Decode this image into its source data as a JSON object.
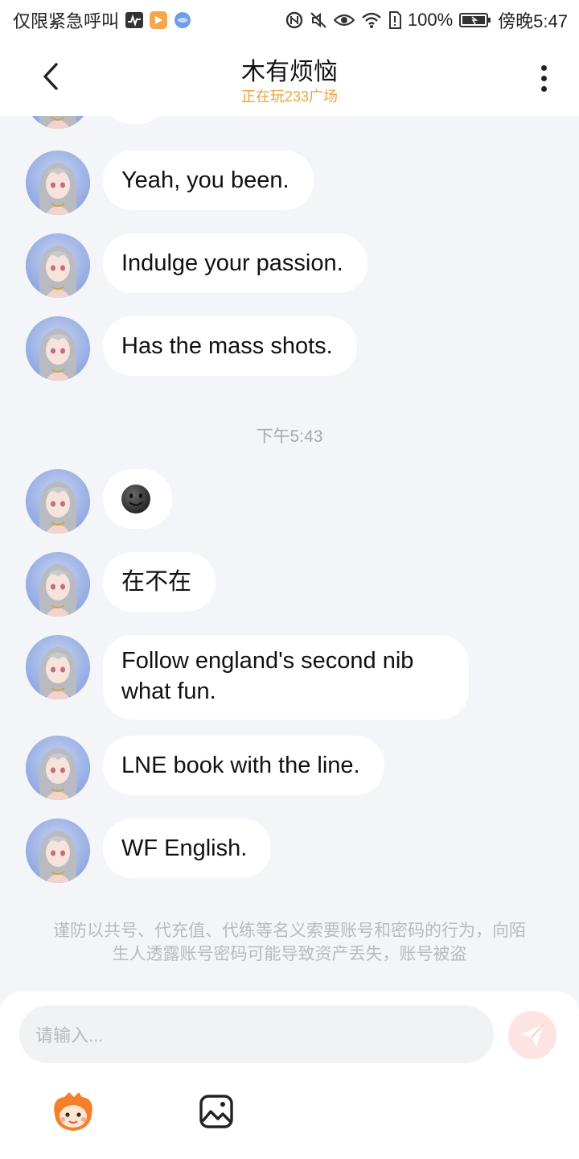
{
  "status_bar": {
    "left_text": "仅限紧急呼叫",
    "battery": "100%",
    "time": "傍晚5:47",
    "icons": [
      "activity-icon",
      "play-app-icon",
      "browser-app-icon",
      "nfc-icon",
      "mute-icon",
      "eye-icon",
      "wifi-icon",
      "sim-icon",
      "battery-icon"
    ]
  },
  "header": {
    "title": "木有烦恼",
    "subtitle": "正在玩233广场",
    "subtitle_color": "#f0a23a",
    "back_icon": "chevron-left-icon",
    "more_icon": "more-vertical-icon"
  },
  "chat": {
    "messages": [
      {
        "text": ""
      },
      {
        "text": "Yeah, you been."
      },
      {
        "text": "Indulge your passion."
      },
      {
        "text": "Has the mass shots."
      },
      {
        "text": "在不在"
      },
      {
        "text": "Follow england's second nib what fun."
      },
      {
        "text": "LNE book with the line."
      },
      {
        "text": "WF English."
      }
    ],
    "emoji_message": "dark-smiley-emoji",
    "timestamp": "下午5:43",
    "warning": "谨防以共号、代充值、代练等名义索要账号和密码的行为，向陌生人透露账号密码可能导致资产丢失，账号被盗"
  },
  "input": {
    "placeholder": "请输入...",
    "send_icon": "paper-plane-icon",
    "send_color": "#fde3e2",
    "tools": [
      "emoji-mascot-icon",
      "image-picker-icon"
    ]
  },
  "colors": {
    "background": "#f3f5f8",
    "bubble": "#ffffff",
    "accent": "#f0a23a"
  }
}
